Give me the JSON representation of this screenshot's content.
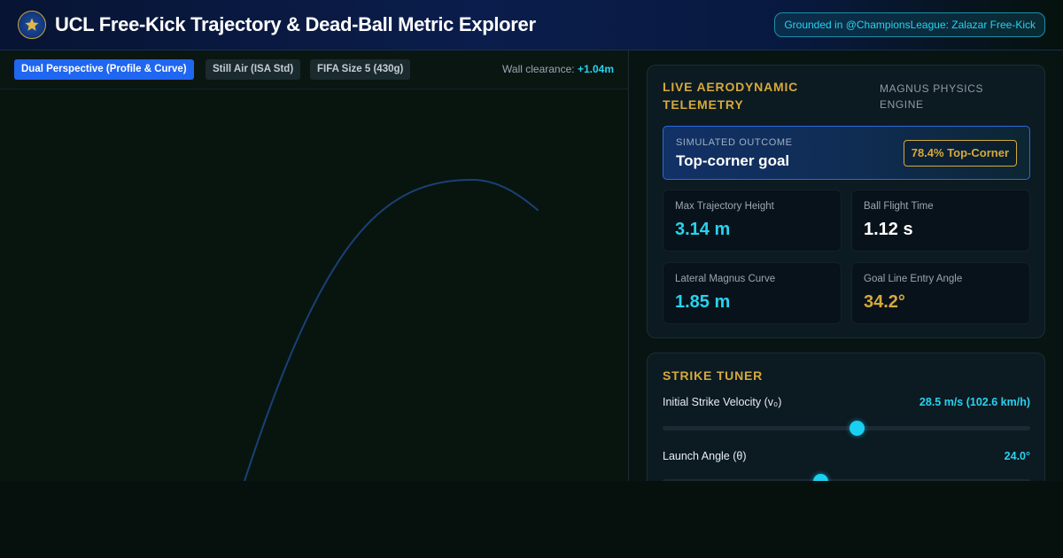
{
  "header": {
    "title": "UCL Free-Kick Trajectory & Dead-Ball Metric Explorer",
    "grounded_badge": "Grounded in @ChampionsLeague: Zalazar Free-Kick"
  },
  "toolbar": {
    "chips": [
      {
        "label": "Dual Perspective (Profile & Curve)",
        "active": true
      },
      {
        "label": "Still Air (ISA Std)",
        "active": false
      },
      {
        "label": "FIFA Size 5 (430g)",
        "active": false
      }
    ],
    "wall_clearance_label": "Wall clearance:",
    "wall_clearance_value": "+1.04m"
  },
  "trajectory": {
    "color": "#1b3f77"
  },
  "telemetry": {
    "title": "LIVE AERODYNAMIC TELEMETRY",
    "engine": "MAGNUS PHYSICS ENGINE",
    "outcome_label": "SIMULATED OUTCOME",
    "outcome_value": "Top-corner goal",
    "probability": "78.4% Top-Corner",
    "metrics": [
      {
        "label": "Max Trajectory Height",
        "value": "3.14 m",
        "tone": "cyan"
      },
      {
        "label": "Ball Flight Time",
        "value": "1.12 s",
        "tone": "white"
      },
      {
        "label": "Lateral Magnus Curve",
        "value": "1.85 m",
        "tone": "cyan"
      },
      {
        "label": "Goal Line Entry Angle",
        "value": "34.2°",
        "tone": "gold"
      }
    ]
  },
  "tuner": {
    "title": "STRIKE TUNER",
    "sliders": [
      {
        "label": "Initial Strike Velocity (v₀)",
        "value": "28.5 m/s (102.6 km/h)",
        "level": 0.53
      },
      {
        "label": "Launch Angle (θ)",
        "value": "24.0°",
        "level": 0.43
      }
    ]
  },
  "colors": {
    "accent_cyan": "#26d3ef",
    "accent_gold": "#d6a93a",
    "active_chip": "#1f66f0"
  }
}
